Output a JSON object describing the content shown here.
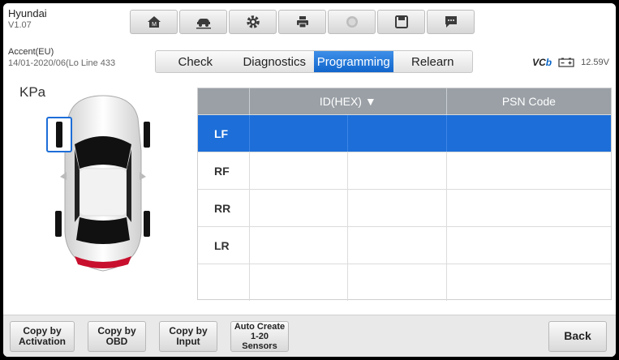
{
  "header": {
    "brand": "Hyundai",
    "version": "V1.07",
    "toolbar": [
      {
        "icon": "home-icon"
      },
      {
        "icon": "car-lift-icon"
      },
      {
        "icon": "gear-icon"
      },
      {
        "icon": "printer-icon"
      },
      {
        "icon": "help-icon"
      },
      {
        "icon": "save-icon"
      },
      {
        "icon": "message-icon"
      }
    ]
  },
  "vehicle": {
    "model": "Accent(EU)",
    "detail": "14/01-2020/06(Lo Line 433"
  },
  "tabs": [
    "Check",
    "Diagnostics",
    "Programming",
    "Relearn"
  ],
  "active_tab": "Programming",
  "status": {
    "vci_prefix": "VC",
    "vci_suffix": "b",
    "voltage": "12.59V"
  },
  "unit": "KPa",
  "table": {
    "headers": [
      "ID(HEX) ▼",
      "PSN Code"
    ],
    "rows": [
      {
        "label": "LF",
        "selected": true
      },
      {
        "label": "RF",
        "selected": false
      },
      {
        "label": "RR",
        "selected": false
      },
      {
        "label": "LR",
        "selected": false
      },
      {
        "label": "",
        "selected": false
      }
    ]
  },
  "buttons": {
    "copy_activation": "Copy by\nActivation",
    "copy_obd": "Copy by\nOBD",
    "copy_input": "Copy by\nInput",
    "auto_create": "Auto Create\n1-20\nSensors",
    "back": "Back"
  },
  "colors": {
    "accent": "#1d6ed8",
    "header_gray": "#9aa0a6"
  }
}
